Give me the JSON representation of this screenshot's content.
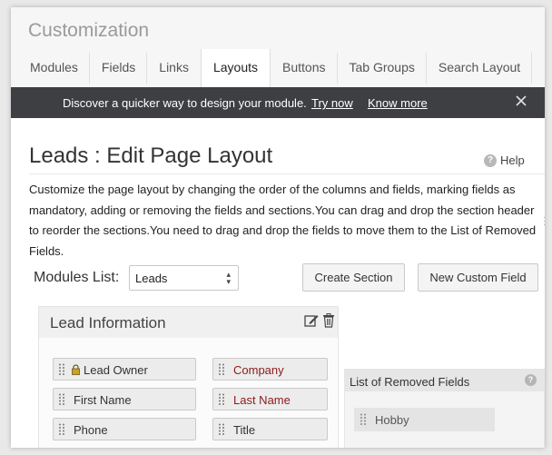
{
  "app": {
    "title": "Customization"
  },
  "tabs": [
    {
      "label": "Modules",
      "active": false
    },
    {
      "label": "Fields",
      "active": false
    },
    {
      "label": "Links",
      "active": false
    },
    {
      "label": "Layouts",
      "active": true
    },
    {
      "label": "Buttons",
      "active": false
    },
    {
      "label": "Tab Groups",
      "active": false
    },
    {
      "label": "Search Layout",
      "active": false
    }
  ],
  "banner": {
    "message": "Discover a quicker way to design your module.",
    "try_now": "Try now",
    "know_more": "Know more",
    "close_icon": "close-icon"
  },
  "page": {
    "title": "Leads : Edit Page Layout",
    "help": "Help",
    "description": "Customize the page layout by changing the order of the columns and fields, marking fields as mandatory, adding or removing the fields and sections.You can drag and drop the section header to reorder the sections.You need to drag and drop the fields to move them to the List of Removed Fields."
  },
  "modules_list": {
    "label": "Modules List:",
    "selected": "Leads"
  },
  "buttons": {
    "create_section": "Create Section",
    "new_custom_field": "New Custom Field"
  },
  "section": {
    "title": "Lead Information",
    "edit_icon": "edit-icon",
    "delete_icon": "trash-icon",
    "left_fields": [
      {
        "label": "Lead Owner",
        "locked": true,
        "required": false
      },
      {
        "label": "First Name",
        "locked": false,
        "required": false
      },
      {
        "label": "Phone",
        "locked": false,
        "required": false
      }
    ],
    "right_fields": [
      {
        "label": "Company",
        "locked": false,
        "required": true
      },
      {
        "label": "Last Name",
        "locked": false,
        "required": true
      },
      {
        "label": "Title",
        "locked": false,
        "required": false
      }
    ]
  },
  "removed_fields": {
    "title": "List of Removed Fields",
    "items": [
      {
        "label": "Hobby"
      }
    ]
  },
  "colors": {
    "banner_bg": "#3d3f42",
    "required_text": "#8b1a1a",
    "header_bg": "#f6f6f6"
  }
}
